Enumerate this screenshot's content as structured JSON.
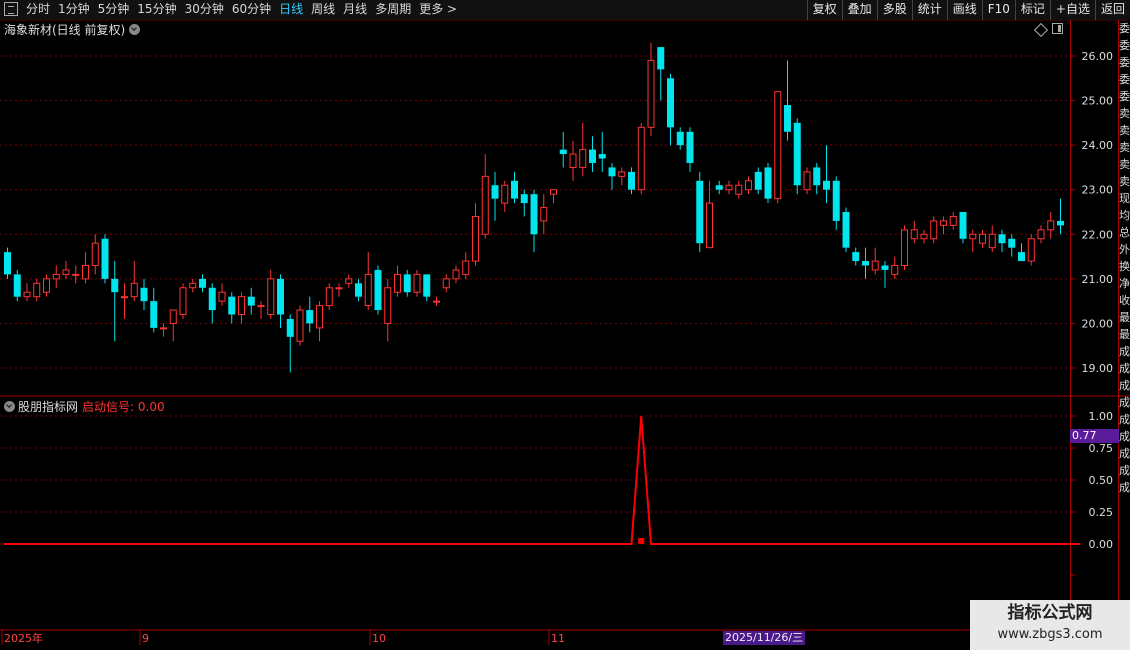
{
  "toolbar": {
    "periods": [
      "分时",
      "1分钟",
      "5分钟",
      "15分钟",
      "30分钟",
      "60分钟",
      "日线",
      "周线",
      "月线",
      "多周期",
      "更多 >"
    ],
    "active_period": "日线",
    "tools": [
      "复权",
      "叠加",
      "多股",
      "统计",
      "画线",
      "F10",
      "标记",
      "+自选",
      "返回"
    ]
  },
  "chart_title": "海象新材(日线 前复权)",
  "indicator": {
    "name": "股朋指标网",
    "signal_label": "启动信号: 0.00",
    "value_tag": "0.77"
  },
  "right_column_chars": [
    "委",
    "委",
    "委",
    "委",
    "委",
    "卖",
    "卖",
    "卖",
    "卖",
    "卖",
    "现",
    "均",
    "总",
    "外",
    "换",
    "净",
    "收",
    "最",
    "最",
    "成",
    "成",
    "成",
    "成",
    "成",
    "成",
    "成",
    "成",
    "成"
  ],
  "date_tag": "2025/11/26/三",
  "watermark": {
    "line1": "指标公式网",
    "line2": "www.zbgs3.com"
  },
  "colors": {
    "up": "#ff3333",
    "down": "#00e5ee",
    "signal": "#ff0000",
    "grid": "#7a0000",
    "bg": "#000000"
  },
  "chart_data": {
    "type": "candlestick",
    "price_axis": {
      "ticks": [
        "26.00",
        "25.00",
        "24.00",
        "23.00",
        "22.00",
        "21.00",
        "20.00",
        "19.00"
      ],
      "ylim": [
        18.6,
        26.4
      ]
    },
    "indicator_axis": {
      "ticks": [
        "1.00",
        "0.75",
        "0.50",
        "0.25",
        "0.00"
      ],
      "ylim": [
        0,
        1
      ]
    },
    "x_labels": [
      "2025年",
      "9",
      "10",
      "11"
    ],
    "candles": [
      [
        21.6,
        21.1,
        21.7,
        21.0
      ],
      [
        21.1,
        20.6,
        21.2,
        20.5
      ],
      [
        20.6,
        20.7,
        20.9,
        20.5
      ],
      [
        20.6,
        20.9,
        21.0,
        20.5
      ],
      [
        20.7,
        21.0,
        21.1,
        20.6
      ],
      [
        21.0,
        21.1,
        21.3,
        20.8
      ],
      [
        21.1,
        21.2,
        21.4,
        21.0
      ],
      [
        21.1,
        21.1,
        21.3,
        20.9
      ],
      [
        21.0,
        21.3,
        21.6,
        20.9
      ],
      [
        21.3,
        21.8,
        22.0,
        21.1
      ],
      [
        21.9,
        21.0,
        22.0,
        20.9
      ],
      [
        21.0,
        20.7,
        21.4,
        19.6
      ],
      [
        20.6,
        20.6,
        20.9,
        20.1
      ],
      [
        20.6,
        20.9,
        21.4,
        20.5
      ],
      [
        20.8,
        20.5,
        21.0,
        20.3
      ],
      [
        20.5,
        19.9,
        20.8,
        19.8
      ],
      [
        19.9,
        19.9,
        20.0,
        19.7
      ],
      [
        20.0,
        20.3,
        20.3,
        19.6
      ],
      [
        20.2,
        20.8,
        20.9,
        20.1
      ],
      [
        20.8,
        20.9,
        21.0,
        20.7
      ],
      [
        21.0,
        20.8,
        21.1,
        20.7
      ],
      [
        20.8,
        20.3,
        20.9,
        20.0
      ],
      [
        20.5,
        20.7,
        20.9,
        20.4
      ],
      [
        20.6,
        20.2,
        20.7,
        20.0
      ],
      [
        20.2,
        20.6,
        20.7,
        20.0
      ],
      [
        20.6,
        20.4,
        20.8,
        20.2
      ],
      [
        20.4,
        20.4,
        20.5,
        20.1
      ],
      [
        20.2,
        21.0,
        21.2,
        20.1
      ],
      [
        21.0,
        20.2,
        21.1,
        19.9
      ],
      [
        20.1,
        19.7,
        20.2,
        18.9
      ],
      [
        19.6,
        20.3,
        20.4,
        19.5
      ],
      [
        20.3,
        20.0,
        20.6,
        19.8
      ],
      [
        19.9,
        20.4,
        20.5,
        19.6
      ],
      [
        20.4,
        20.8,
        20.9,
        20.3
      ],
      [
        20.8,
        20.8,
        20.9,
        20.6
      ],
      [
        20.9,
        21.0,
        21.1,
        20.8
      ],
      [
        20.9,
        20.6,
        21.0,
        20.5
      ],
      [
        20.4,
        21.1,
        21.6,
        20.3
      ],
      [
        21.2,
        20.3,
        21.3,
        20.2
      ],
      [
        20.0,
        20.8,
        21.0,
        19.6
      ],
      [
        20.7,
        21.1,
        21.3,
        20.6
      ],
      [
        21.1,
        20.7,
        21.2,
        20.6
      ],
      [
        20.7,
        21.1,
        21.2,
        20.6
      ],
      [
        21.1,
        20.6,
        21.1,
        20.5
      ],
      [
        20.5,
        20.5,
        20.6,
        20.4
      ],
      [
        20.8,
        21.0,
        21.1,
        20.7
      ],
      [
        21.0,
        21.2,
        21.3,
        20.9
      ],
      [
        21.1,
        21.4,
        21.6,
        21.0
      ],
      [
        21.4,
        22.4,
        22.7,
        21.3
      ],
      [
        22.0,
        23.3,
        23.8,
        21.9
      ],
      [
        23.1,
        22.8,
        23.4,
        22.3
      ],
      [
        22.7,
        23.1,
        23.2,
        22.5
      ],
      [
        23.2,
        22.8,
        23.4,
        22.7
      ],
      [
        22.9,
        22.7,
        23.0,
        22.4
      ],
      [
        22.9,
        22.0,
        23.0,
        21.6
      ],
      [
        22.3,
        22.6,
        22.9,
        22.0
      ],
      [
        22.9,
        23.0,
        23.0,
        22.7
      ],
      [
        23.9,
        23.8,
        24.3,
        23.5
      ],
      [
        23.5,
        23.8,
        24.1,
        23.2
      ],
      [
        23.5,
        23.9,
        24.5,
        23.3
      ],
      [
        23.9,
        23.6,
        24.2,
        23.4
      ],
      [
        23.8,
        23.7,
        24.3,
        23.4
      ],
      [
        23.5,
        23.3,
        23.6,
        23.0
      ],
      [
        23.3,
        23.4,
        23.5,
        23.1
      ],
      [
        23.4,
        23.0,
        23.5,
        22.9
      ],
      [
        23.0,
        24.4,
        24.5,
        22.9
      ],
      [
        24.4,
        25.9,
        26.3,
        24.2
      ],
      [
        26.2,
        25.7,
        26.2,
        25.0
      ],
      [
        25.5,
        24.4,
        25.6,
        24.0
      ],
      [
        24.3,
        24.0,
        24.4,
        23.9
      ],
      [
        24.3,
        23.6,
        24.4,
        23.4
      ],
      [
        23.2,
        21.8,
        23.4,
        21.6
      ],
      [
        21.7,
        22.7,
        23.2,
        21.7
      ],
      [
        23.1,
        23.0,
        23.2,
        22.9
      ],
      [
        23.0,
        23.1,
        23.2,
        22.9
      ],
      [
        22.9,
        23.1,
        23.2,
        22.8
      ],
      [
        23.0,
        23.2,
        23.3,
        22.9
      ],
      [
        23.4,
        23.0,
        23.5,
        22.9
      ],
      [
        23.5,
        22.8,
        23.6,
        22.7
      ],
      [
        22.8,
        25.2,
        25.2,
        22.7
      ],
      [
        24.9,
        24.3,
        25.9,
        24.1
      ],
      [
        24.5,
        23.1,
        24.6,
        22.9
      ],
      [
        23.0,
        23.4,
        23.5,
        22.9
      ],
      [
        23.5,
        23.1,
        23.6,
        22.9
      ],
      [
        23.2,
        23.0,
        24.0,
        22.7
      ],
      [
        23.2,
        22.3,
        23.3,
        22.1
      ],
      [
        22.5,
        21.7,
        22.6,
        21.6
      ],
      [
        21.6,
        21.4,
        21.7,
        21.3
      ],
      [
        21.4,
        21.3,
        21.7,
        21.0
      ],
      [
        21.2,
        21.4,
        21.7,
        21.1
      ],
      [
        21.3,
        21.2,
        21.4,
        20.8
      ],
      [
        21.1,
        21.3,
        21.5,
        21.0
      ],
      [
        21.3,
        22.1,
        22.2,
        21.2
      ],
      [
        21.9,
        22.1,
        22.3,
        21.8
      ],
      [
        21.9,
        22.0,
        22.1,
        21.8
      ],
      [
        21.9,
        22.3,
        22.4,
        21.8
      ],
      [
        22.2,
        22.3,
        22.4,
        22.0
      ],
      [
        22.2,
        22.4,
        22.5,
        22.1
      ],
      [
        22.5,
        21.9,
        22.5,
        21.8
      ],
      [
        21.9,
        22.0,
        22.1,
        21.6
      ],
      [
        21.8,
        22.0,
        22.1,
        21.7
      ],
      [
        21.7,
        22.0,
        22.2,
        21.6
      ],
      [
        22.0,
        21.8,
        22.1,
        21.6
      ],
      [
        21.9,
        21.7,
        22.0,
        21.5
      ],
      [
        21.6,
        21.4,
        21.8,
        21.4
      ],
      [
        21.4,
        21.9,
        22.0,
        21.3
      ],
      [
        21.9,
        22.1,
        22.2,
        21.8
      ],
      [
        22.1,
        22.3,
        22.5,
        21.9
      ],
      [
        22.3,
        22.2,
        22.8,
        22.0
      ]
    ],
    "signal_values": [
      0,
      0,
      0,
      0,
      0,
      0,
      0,
      0,
      0,
      0,
      0,
      0,
      0,
      0,
      0,
      0,
      0,
      0,
      0,
      0,
      0,
      0,
      0,
      0,
      0,
      0,
      0,
      0,
      0,
      0,
      0,
      0,
      0,
      0,
      0,
      0,
      0,
      0,
      0,
      0,
      0,
      0,
      0,
      0,
      0,
      0,
      0,
      0,
      0,
      0,
      0,
      0,
      0,
      0,
      0,
      0,
      0,
      0,
      0,
      0,
      0,
      0,
      0,
      0,
      0,
      1,
      0,
      0,
      0,
      0,
      0,
      0,
      0,
      0,
      0,
      0,
      0,
      0,
      0,
      0,
      0,
      0,
      0,
      0,
      0,
      0,
      0,
      0,
      0,
      0,
      0,
      0,
      0,
      0,
      0,
      0,
      0,
      0,
      0,
      0,
      0,
      0,
      0,
      0,
      0,
      0,
      0,
      0,
      0,
      0,
      0
    ]
  }
}
